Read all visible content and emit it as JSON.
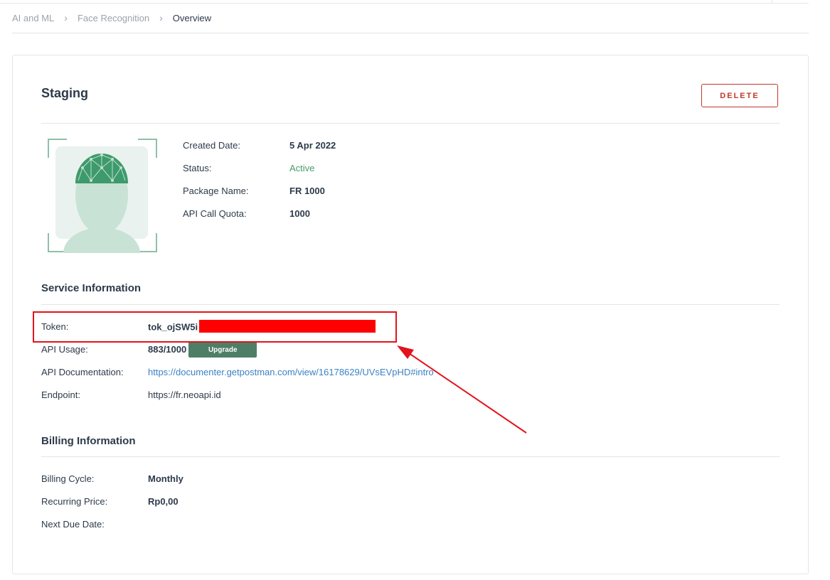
{
  "breadcrumb": {
    "items": [
      "AI and ML",
      "Face Recognition",
      "Overview"
    ],
    "separator": "›"
  },
  "page": {
    "title": "Staging",
    "delete_label": "DELETE"
  },
  "summary": {
    "created_label": "Created Date:",
    "created_value": "5 Apr 2022",
    "status_label": "Status:",
    "status_value": "Active",
    "package_label": "Package Name:",
    "package_value": "FR 1000",
    "quota_label": "API Call Quota:",
    "quota_value": "1000"
  },
  "service": {
    "title": "Service Information",
    "token_label": "Token:",
    "token_value": "tok_ojSW5i",
    "usage_label": "API Usage:",
    "usage_value": "883/1000",
    "upgrade_label": "Upgrade",
    "docs_label": "API Documentation:",
    "docs_value": "https://documenter.getpostman.com/view/16178629/UVsEVpHD#intro",
    "endpoint_label": "Endpoint:",
    "endpoint_value": "https://fr.neoapi.id"
  },
  "billing": {
    "title": "Billing Information",
    "cycle_label": "Billing Cycle:",
    "cycle_value": "Monthly",
    "price_label": "Recurring Price:",
    "price_value": "Rp0,00",
    "due_label": "Next Due Date:",
    "due_value": ""
  },
  "colors": {
    "accent_green": "#4a9a6b",
    "button_green": "#4f7e67",
    "danger": "#c0392b",
    "link": "#3b82c4",
    "annotation_red": "#e3131b"
  },
  "icons": [
    "chevron-right-icon",
    "face-recognition-illustration",
    "annotation-arrow"
  ]
}
